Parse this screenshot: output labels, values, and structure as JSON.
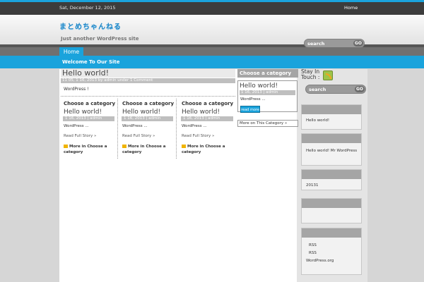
{
  "topbar": {
    "date": "Sat, December 12, 2015",
    "nav_home": "Home"
  },
  "header": {
    "logo": "まとめちゃんねる",
    "tagline": "Just another WordPress site",
    "search_placeholder": "search",
    "search_button": "GO"
  },
  "nav": {
    "home": "Home"
  },
  "welcome": "Welcome To Our Site",
  "post": {
    "title": "Hello world!",
    "meta": "11 05, 1 16, 2013 by admin  under   1 Comment",
    "excerpt": "WordPress  !"
  },
  "columns": [
    {
      "heading": "Choose a category",
      "title": "Hello world!",
      "meta": "1 16, 2013 | admin",
      "excerpt": "WordPress ...",
      "read": "Read Full Story »",
      "more": "More in Choose a category"
    },
    {
      "heading": "Choose a category",
      "title": "Hello world!",
      "meta": "1 16, 2013 | admin",
      "excerpt": "WordPress ...",
      "read": "Read Full Story »",
      "more": "More in Choose a category"
    },
    {
      "heading": "Choose a category",
      "title": "Hello world!",
      "meta": "1 16, 2013 | admin",
      "excerpt": "WordPress ...",
      "read": "Read Full Story »",
      "more": "More in Choose a category"
    }
  ],
  "featured": {
    "heading": "Choose a category",
    "title": "Hello world!",
    "meta": "1 16, 2013 | admin",
    "excerpt": "WordPress ...",
    "button": "read more",
    "more": "More on This Category »"
  },
  "sidebar": {
    "stay_in_touch": "Stay In Touch :",
    "search_placeholder": "search",
    "search_button": "GO",
    "widget1": "Hello world!",
    "widget2": "Hello world!     Mr WordPress",
    "widget3": "20131",
    "widget5_items": [
      "RSS",
      "RSS",
      "WordPress.org"
    ]
  },
  "colors": {
    "accent": "#1aa3dc",
    "topbar": "#3c3c3c",
    "sidebar_head": "#a5a5a5"
  }
}
